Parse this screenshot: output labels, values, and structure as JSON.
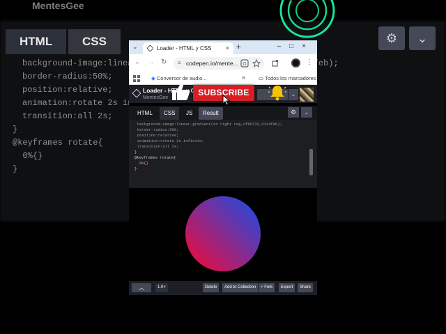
{
  "background": {
    "channel_partial": "MentesGee",
    "tabs": [
      "HTML",
      "CSS"
    ],
    "code_lines": [
      "background-image:linear-gradient(to right top,#fb0732,#124feb);",
      "border-radius:50%;",
      "position:relative;",
      "animation:rotate 2s infinite;",
      "transition:all 2s;",
      "}",
      "@keyframes rotate{",
      "  0%{}",
      "}"
    ],
    "gear_glyph": "⚙",
    "chevron_glyph": "⌄"
  },
  "browser": {
    "tab_title": "Loader - HTML y CSS",
    "tab_close": "×",
    "new_tab": "+",
    "tab_dropdown": "⌄",
    "window_controls": "–□×",
    "url": "codepen.io/mente...",
    "back": "←",
    "forward": "→",
    "reload": "↻",
    "bookmarks": {
      "item1": "Conversor de audio...",
      "more": "»",
      "all_bookmarks": "Todos los marcadores"
    }
  },
  "codepen": {
    "pen_title": "Loader - HTML y CSS",
    "user": "MentesGee",
    "subscribe": "SUBSCRIBE",
    "tabs": {
      "html": "HTML",
      "css": "CSS",
      "js": "JS",
      "result": "Result"
    },
    "gear_glyph": "⚙",
    "chevron_glyph": "⌄",
    "code_lines": [
      "background-image:linear-gradient(to right top,#fb0732,#124feb);",
      "border-radius:50%;",
      "position:relative;",
      "animation:rotate 2s infinite;",
      "transition:all 2s;",
      "}",
      "@keyframes rotate{",
      "  0%{}",
      "}"
    ],
    "footer": {
      "up": "︿",
      "zoom": "1.0×",
      "delete": "Delete",
      "add_to_collection": "Add to Collection",
      "fork": "⑂ Fork",
      "export": "Export",
      "share": "Share"
    }
  },
  "colors": {
    "gradient_start": "#fb0732",
    "gradient_end": "#124feb",
    "subscribe_red": "#d81d25",
    "neon_green": "#19ffa8"
  }
}
